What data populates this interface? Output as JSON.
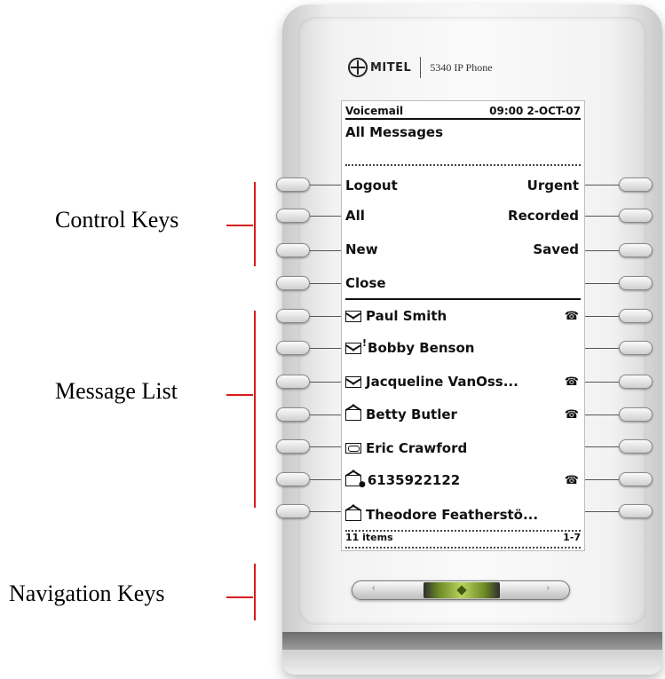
{
  "callouts": {
    "control_keys": "Control Keys",
    "message_list": "Message List",
    "navigation_keys": "Navigation Keys"
  },
  "brand": {
    "name": "MITEL",
    "model": "5340 IP Phone"
  },
  "screen": {
    "header_left": "Voicemail",
    "header_right": "09:00 2-OCT-07",
    "subtitle": "All Messages",
    "controls": [
      {
        "left": "Logout",
        "right": "Urgent"
      },
      {
        "left": "All",
        "right": "Recorded"
      },
      {
        "left": "New",
        "right": "Saved"
      },
      {
        "left": "Close",
        "right": ""
      }
    ],
    "messages": [
      {
        "name": "Paul Smith",
        "icon": "envelope-icon",
        "callback": true
      },
      {
        "name": "Bobby Benson",
        "icon": "urgent-envelope-icon",
        "callback": false
      },
      {
        "name": "Jacqueline VanOss...",
        "icon": "envelope-icon",
        "callback": true
      },
      {
        "name": "Betty Butler",
        "icon": "open-envelope-icon",
        "callback": true
      },
      {
        "name": "Eric Crawford",
        "icon": "recording-icon",
        "callback": false
      },
      {
        "name": "6135922122",
        "icon": "locked-envelope-icon",
        "callback": true
      },
      {
        "name": "Theodore Featherstö...",
        "icon": "open-envelope-icon",
        "callback": false
      }
    ],
    "footer_left": "11 items",
    "footer_right": "1-7",
    "urgent_mark": "!",
    "callback_glyph": "☎"
  },
  "nav": {
    "left_glyph": "‹",
    "right_glyph": "›"
  },
  "colors": {
    "callout_line": "#d81b1b",
    "nav_center": "#b9d45e"
  }
}
